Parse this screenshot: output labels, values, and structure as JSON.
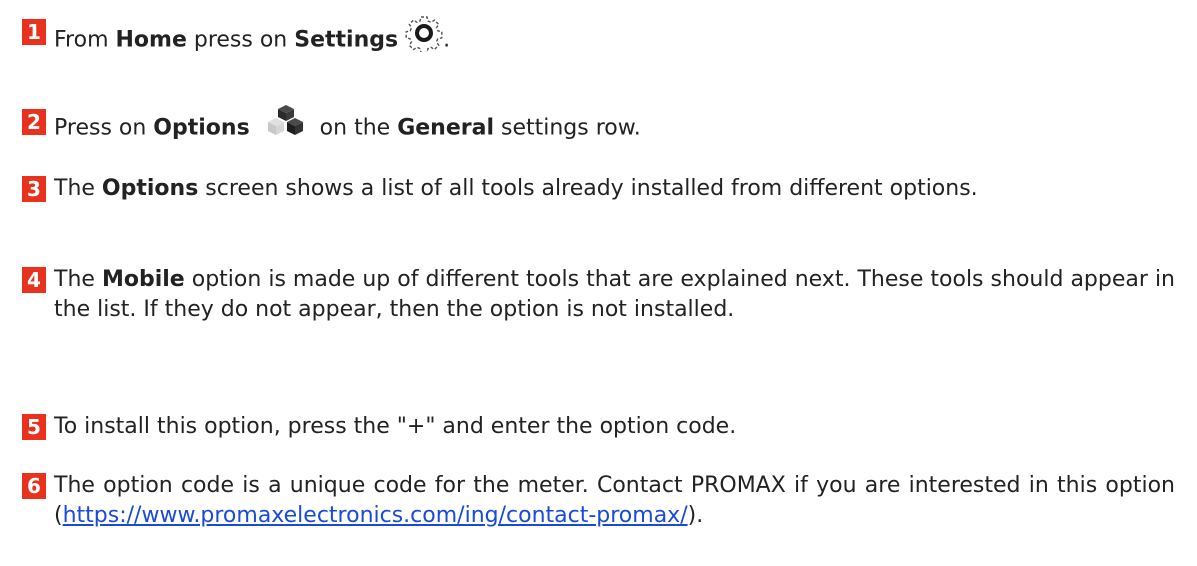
{
  "steps": [
    {
      "number": "1",
      "parts": {
        "a": "From ",
        "b": "Home",
        "c": " press on ",
        "d": "Settings",
        "e": "."
      },
      "icon": "gear-icon"
    },
    {
      "number": "2",
      "parts": {
        "a": "Press on ",
        "b": "Options",
        "c": " on the ",
        "d": "General",
        "e": " settings row."
      },
      "icon": "cubes-icon"
    },
    {
      "number": "3",
      "parts": {
        "a": "The ",
        "b": "Options",
        "c": " screen shows a list of all tools already installed from different options."
      }
    },
    {
      "number": "4",
      "parts": {
        "a": "The ",
        "b": "Mobile",
        "c": " option is made up of different tools that are explained next. These tools should appear in the list. If they do not appear, then the option is not installed."
      }
    },
    {
      "number": "5",
      "parts": {
        "a": "To install this option, press the \"+\" and enter the option code."
      }
    },
    {
      "number": "6",
      "parts": {
        "a": "The option code is a unique code for the meter. Contact PROMAX if you are interested in this option (",
        "link": "https://www.promaxelectronics.com/ing/contact-promax/",
        "b": ")."
      }
    }
  ],
  "colors": {
    "badge": "#e8321e",
    "text": "#222222",
    "link": "#1a4bd6"
  }
}
